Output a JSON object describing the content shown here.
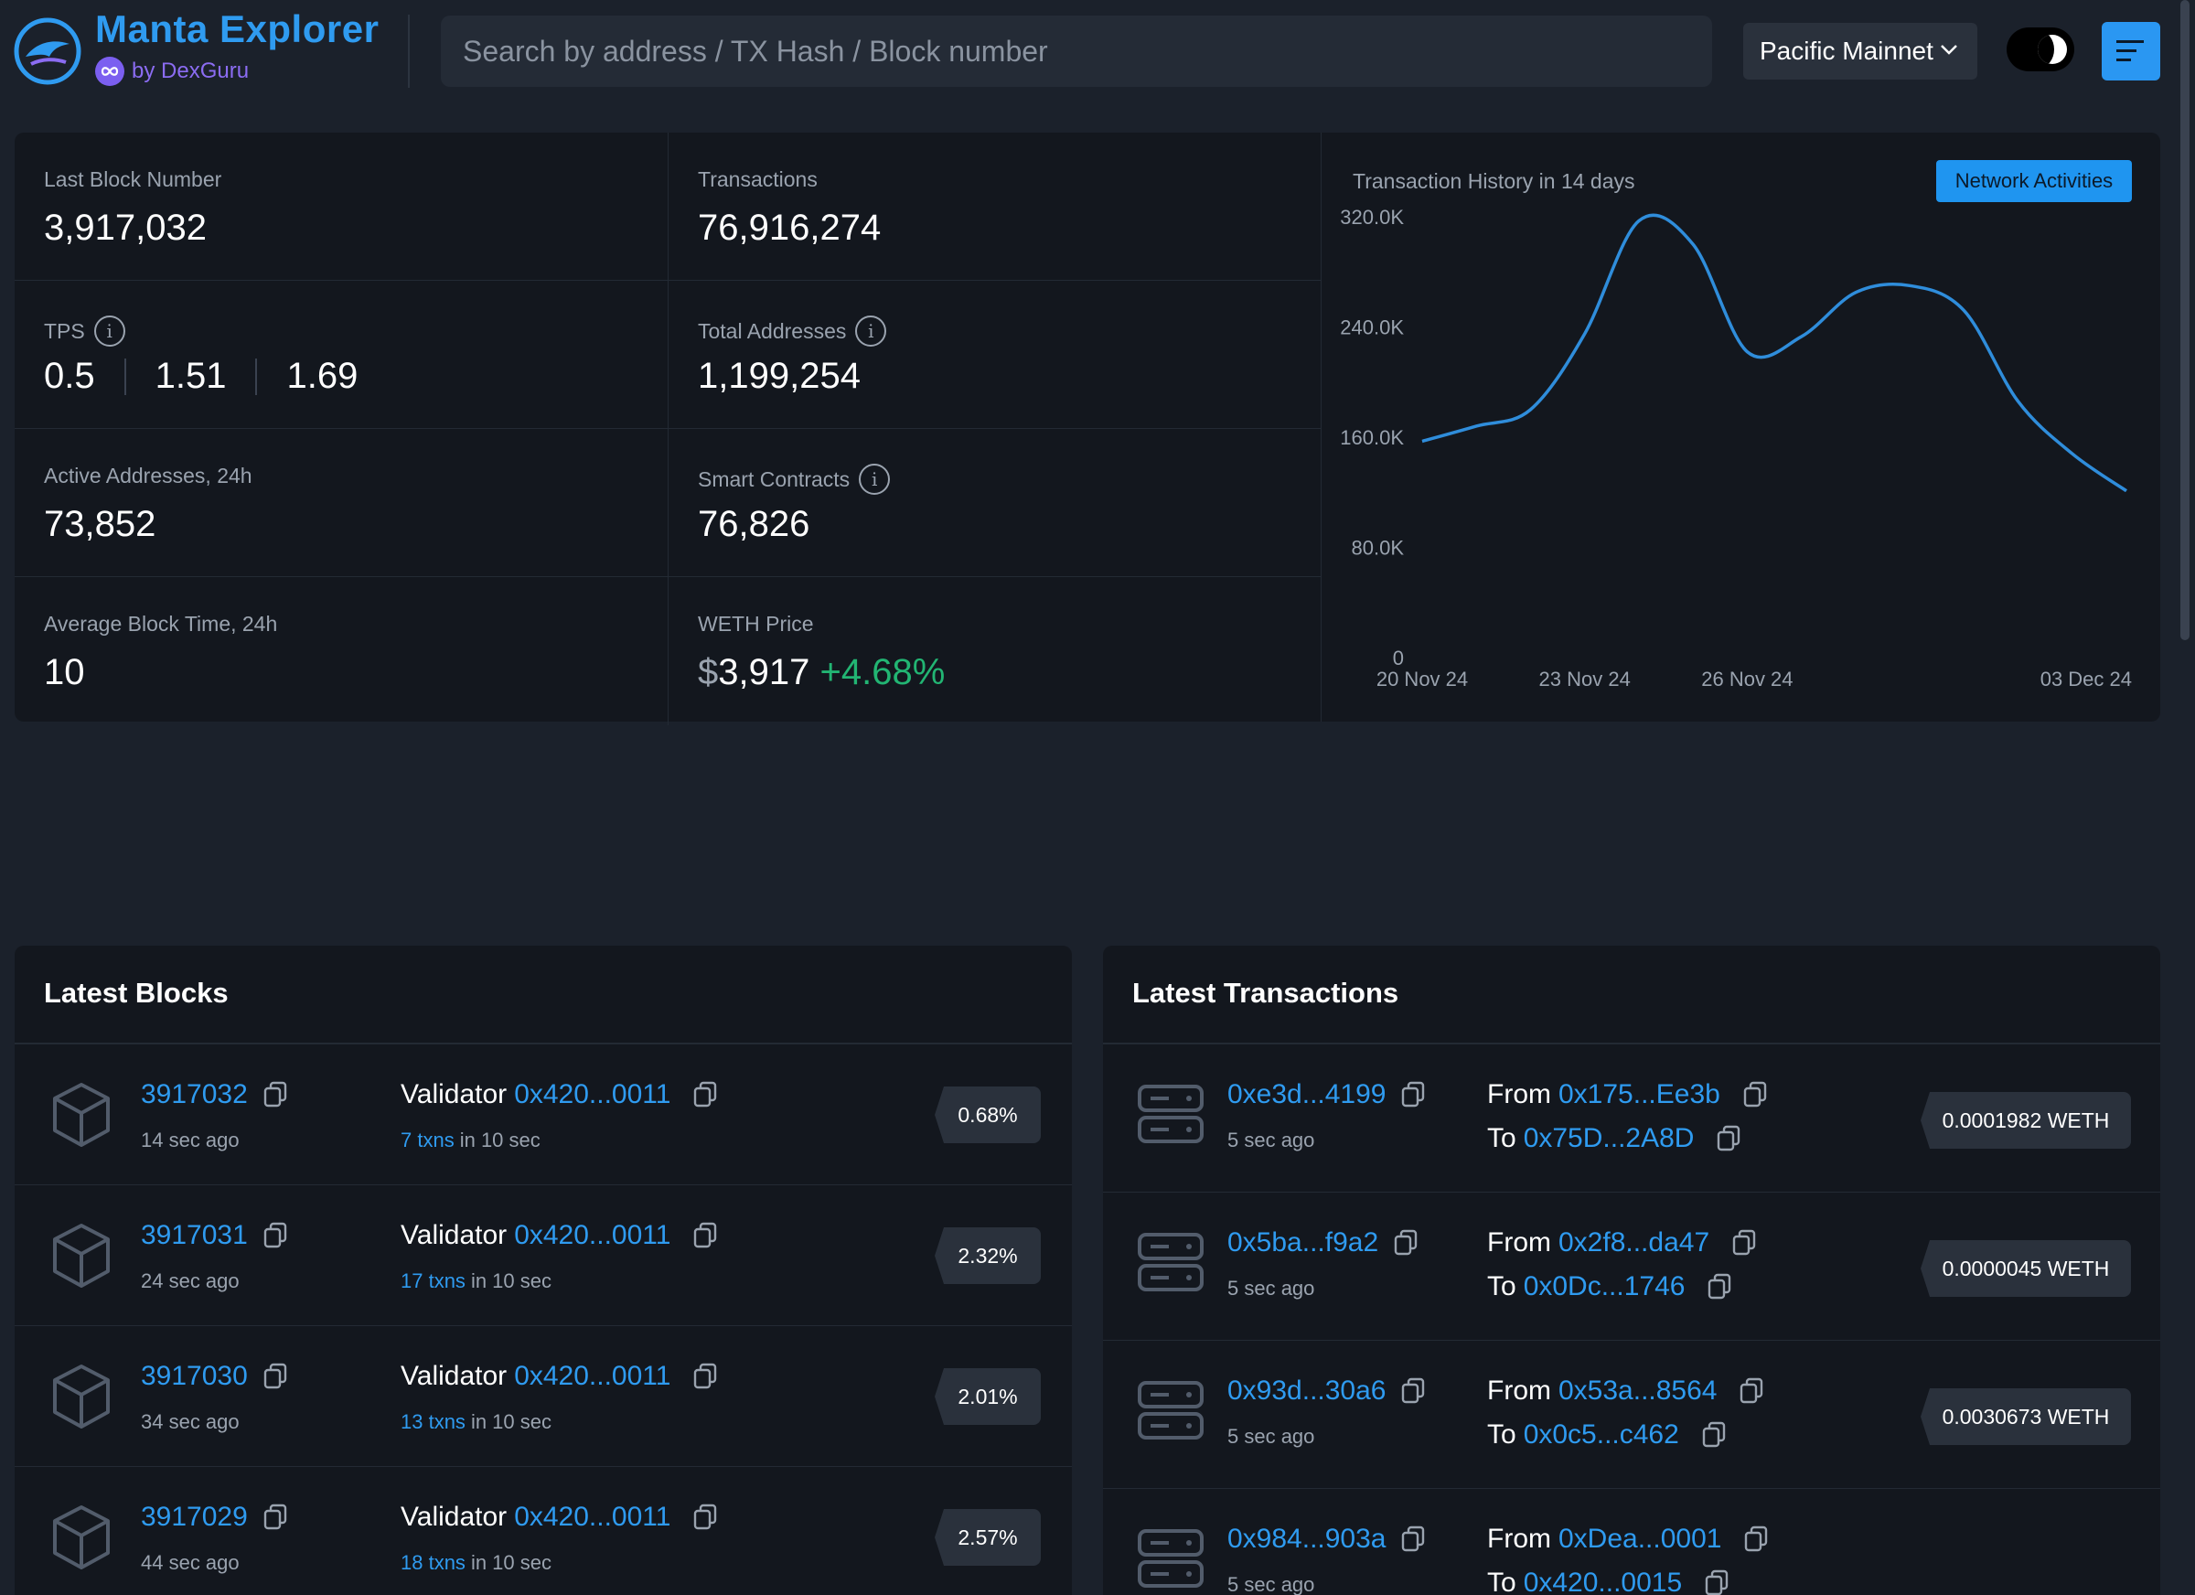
{
  "header": {
    "title": "Manta Explorer",
    "subtitle": "by DexGuru",
    "search_placeholder": "Search by address / TX Hash / Block number",
    "network": "Pacific Mainnet"
  },
  "stats": {
    "last_block_label": "Last Block Number",
    "last_block_value": "3,917,032",
    "transactions_label": "Transactions",
    "transactions_value": "76,916,274",
    "tps_label": "TPS",
    "tps_values": [
      "0.5",
      "1.51",
      "1.69"
    ],
    "total_addresses_label": "Total Addresses",
    "total_addresses_value": "1,199,254",
    "active_addresses_label": "Active Addresses, 24h",
    "active_addresses_value": "73,852",
    "smart_contracts_label": "Smart Contracts",
    "smart_contracts_value": "76,826",
    "avg_block_time_label": "Average Block Time, 24h",
    "avg_block_time_value": "10",
    "weth_price_label": "WETH Price",
    "weth_currency": "$",
    "weth_price_value": "3,917",
    "weth_change": "+4.68%"
  },
  "chart_title": "Transaction History in 14 days",
  "chart_button": "Network Activities",
  "chart_data": {
    "type": "line",
    "title": "Transaction History in 14 days",
    "x": [
      "20 Nov 24",
      "21 Nov 24",
      "22 Nov 24",
      "23 Nov 24",
      "24 Nov 24",
      "25 Nov 24",
      "26 Nov 24",
      "27 Nov 24",
      "28 Nov 24",
      "29 Nov 24",
      "30 Nov 24",
      "01 Dec 24",
      "02 Dec 24",
      "03 Dec 24"
    ],
    "x_tick_labels": [
      "20 Nov 24",
      "23 Nov 24",
      "26 Nov 24",
      "03 Dec 24"
    ],
    "values": [
      157000,
      168000,
      180000,
      235000,
      317000,
      300000,
      222000,
      233000,
      265000,
      270000,
      252000,
      186000,
      148000,
      121000
    ],
    "y_tick_labels": [
      "320.0K",
      "240.0K",
      "160.0K",
      "80.0K",
      "0"
    ],
    "ylim": [
      0,
      320000
    ],
    "grid": false,
    "line_color": "#2f8ddb"
  },
  "blocks": {
    "title": "Latest Blocks",
    "validator_label": "Validator",
    "in_label": "in 10 sec",
    "rows": [
      {
        "number": "3917032",
        "age": "14 sec ago",
        "validator": "0x420...0011",
        "txns": "7 txns",
        "pct": "0.68%"
      },
      {
        "number": "3917031",
        "age": "24 sec ago",
        "validator": "0x420...0011",
        "txns": "17 txns",
        "pct": "2.32%"
      },
      {
        "number": "3917030",
        "age": "34 sec ago",
        "validator": "0x420...0011",
        "txns": "13 txns",
        "pct": "2.01%"
      },
      {
        "number": "3917029",
        "age": "44 sec ago",
        "validator": "0x420...0011",
        "txns": "18 txns",
        "pct": "2.57%"
      }
    ]
  },
  "transactions": {
    "title": "Latest Transactions",
    "from_label": "From",
    "to_label": "To",
    "rows": [
      {
        "hash": "0xe3d...4199",
        "age": "5 sec ago",
        "from": "0x175...Ee3b",
        "to": "0x75D...2A8D",
        "value": "0.0001982 WETH"
      },
      {
        "hash": "0x5ba...f9a2",
        "age": "5 sec ago",
        "from": "0x2f8...da47",
        "to": "0x0Dc...1746",
        "value": "0.0000045 WETH"
      },
      {
        "hash": "0x93d...30a6",
        "age": "5 sec ago",
        "from": "0x53a...8564",
        "to": "0x0c5...c462",
        "value": "0.0030673 WETH"
      },
      {
        "hash": "0x984...903a",
        "age": "5 sec ago",
        "from": "0xDea...0001",
        "to": "0x420...0015",
        "value": ""
      }
    ]
  },
  "colors": {
    "background": "#1b212b",
    "panel": "#13171e",
    "accent": "#2f9bf0",
    "positive": "#22b573",
    "brand_purple": "#7b5ff0"
  }
}
